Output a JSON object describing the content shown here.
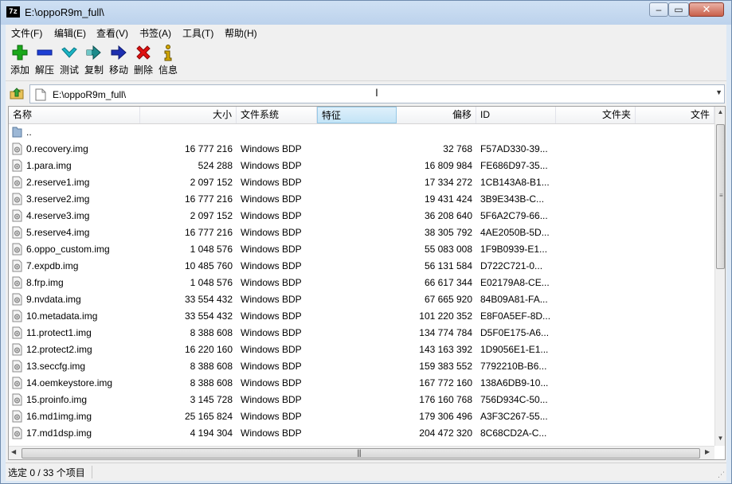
{
  "window": {
    "title": "E:\\oppoR9m_full\\",
    "app_icon_text": "7z"
  },
  "menu": [
    {
      "label": "文件(F)"
    },
    {
      "label": "编辑(E)"
    },
    {
      "label": "查看(V)"
    },
    {
      "label": "书签(A)"
    },
    {
      "label": "工具(T)"
    },
    {
      "label": "帮助(H)"
    }
  ],
  "toolbar": [
    {
      "label": "添加",
      "icon": "plus-icon",
      "color": "#1aa81a"
    },
    {
      "label": "解压",
      "icon": "minus-icon",
      "color": "#1d3fd4"
    },
    {
      "label": "测试",
      "icon": "check-icon",
      "color": "#1bb4c4"
    },
    {
      "label": "复制",
      "icon": "double-arrow-icon",
      "color": "#1c8a8a"
    },
    {
      "label": "移动",
      "icon": "arrow-right-icon",
      "color": "#1d2fb0"
    },
    {
      "label": "删除",
      "icon": "x-icon",
      "color": "#e01010"
    },
    {
      "label": "信息",
      "icon": "info-icon",
      "color": "#d4a800"
    }
  ],
  "address": {
    "path": "E:\\oppoR9m_full\\"
  },
  "columns": [
    {
      "key": "name",
      "label": "名称"
    },
    {
      "key": "size",
      "label": "大小"
    },
    {
      "key": "fs",
      "label": "文件系统"
    },
    {
      "key": "feature",
      "label": "特征"
    },
    {
      "key": "offset",
      "label": "偏移"
    },
    {
      "key": "id",
      "label": "ID"
    },
    {
      "key": "folder",
      "label": "文件夹"
    },
    {
      "key": "files",
      "label": "文件"
    }
  ],
  "parent_row": {
    "name": ".."
  },
  "rows": [
    {
      "name": "0.recovery.img",
      "size": "16 777 216",
      "fs": "Windows BDP",
      "offset": "32 768",
      "id": "F57AD330-39..."
    },
    {
      "name": "1.para.img",
      "size": "524 288",
      "fs": "Windows BDP",
      "offset": "16 809 984",
      "id": "FE686D97-35..."
    },
    {
      "name": "2.reserve1.img",
      "size": "2 097 152",
      "fs": "Windows BDP",
      "offset": "17 334 272",
      "id": "1CB143A8-B1..."
    },
    {
      "name": "3.reserve2.img",
      "size": "16 777 216",
      "fs": "Windows BDP",
      "offset": "19 431 424",
      "id": "3B9E343B-C..."
    },
    {
      "name": "4.reserve3.img",
      "size": "2 097 152",
      "fs": "Windows BDP",
      "offset": "36 208 640",
      "id": "5F6A2C79-66..."
    },
    {
      "name": "5.reserve4.img",
      "size": "16 777 216",
      "fs": "Windows BDP",
      "offset": "38 305 792",
      "id": "4AE2050B-5D..."
    },
    {
      "name": "6.oppo_custom.img",
      "size": "1 048 576",
      "fs": "Windows BDP",
      "offset": "55 083 008",
      "id": "1F9B0939-E1..."
    },
    {
      "name": "7.expdb.img",
      "size": "10 485 760",
      "fs": "Windows BDP",
      "offset": "56 131 584",
      "id": "D722C721-0..."
    },
    {
      "name": "8.frp.img",
      "size": "1 048 576",
      "fs": "Windows BDP",
      "offset": "66 617 344",
      "id": "E02179A8-CE..."
    },
    {
      "name": "9.nvdata.img",
      "size": "33 554 432",
      "fs": "Windows BDP",
      "offset": "67 665 920",
      "id": "84B09A81-FA..."
    },
    {
      "name": "10.metadata.img",
      "size": "33 554 432",
      "fs": "Windows BDP",
      "offset": "101 220 352",
      "id": "E8F0A5EF-8D..."
    },
    {
      "name": "11.protect1.img",
      "size": "8 388 608",
      "fs": "Windows BDP",
      "offset": "134 774 784",
      "id": "D5F0E175-A6..."
    },
    {
      "name": "12.protect2.img",
      "size": "16 220 160",
      "fs": "Windows BDP",
      "offset": "143 163 392",
      "id": "1D9056E1-E1..."
    },
    {
      "name": "13.seccfg.img",
      "size": "8 388 608",
      "fs": "Windows BDP",
      "offset": "159 383 552",
      "id": "7792210B-B6..."
    },
    {
      "name": "14.oemkeystore.img",
      "size": "8 388 608",
      "fs": "Windows BDP",
      "offset": "167 772 160",
      "id": "138A6DB9-10..."
    },
    {
      "name": "15.proinfo.img",
      "size": "3 145 728",
      "fs": "Windows BDP",
      "offset": "176 160 768",
      "id": "756D934C-50..."
    },
    {
      "name": "16.md1img.img",
      "size": "25 165 824",
      "fs": "Windows BDP",
      "offset": "179 306 496",
      "id": "A3F3C267-55..."
    },
    {
      "name": "17.md1dsp.img",
      "size": "4 194 304",
      "fs": "Windows BDP",
      "offset": "204 472 320",
      "id": "8C68CD2A-C..."
    }
  ],
  "status": {
    "text": "选定 0 / 33 个项目"
  }
}
